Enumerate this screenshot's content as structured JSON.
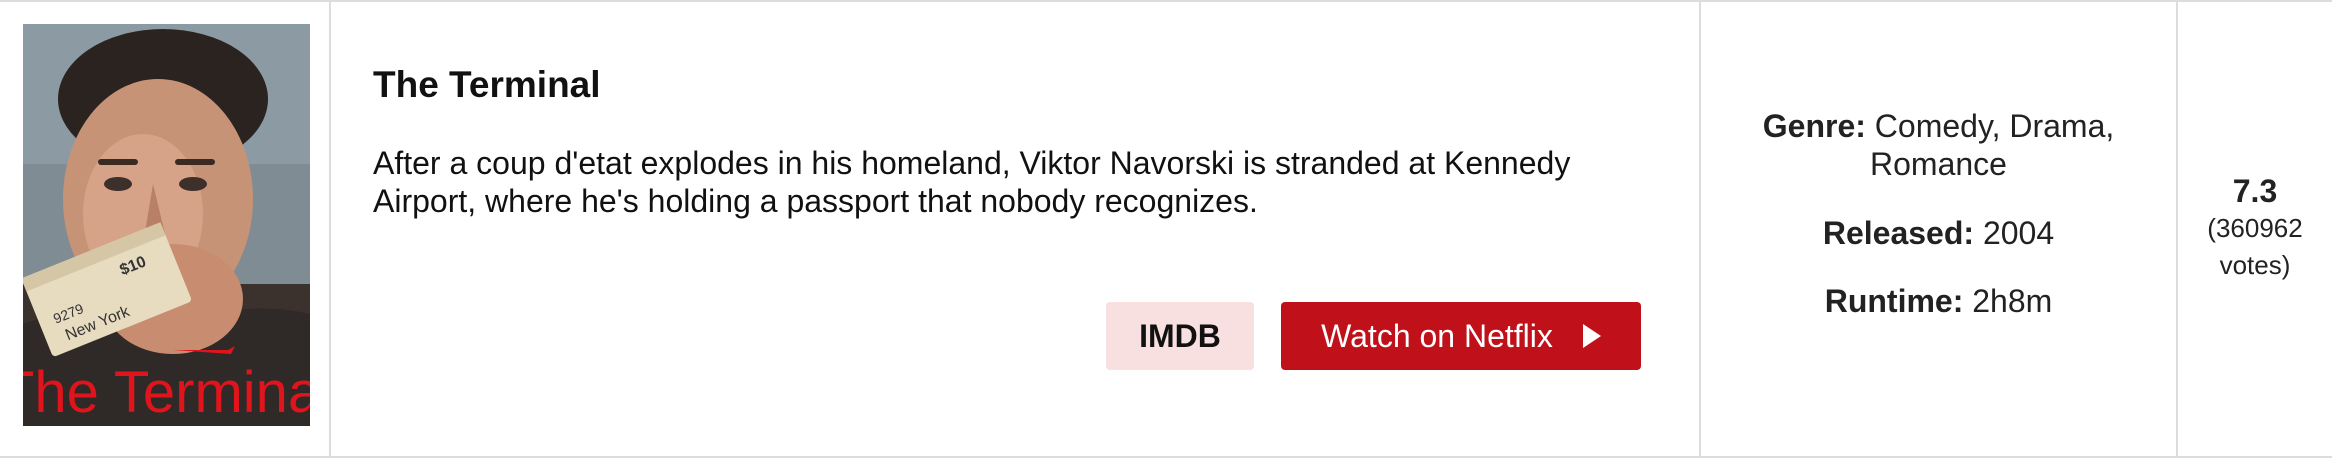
{
  "movie": {
    "title": "The Terminal",
    "description": "After a coup d'etat explodes in his homeland, Viktor Navorski is stranded at Kennedy Airport, where he's holding a passport that nobody recognizes.",
    "poster": {
      "title_art": "The Terminal",
      "ticket_text": "New York",
      "ticket_price": "$10",
      "ticket_code": "9279"
    }
  },
  "buttons": {
    "imdb_label": "IMDB",
    "netflix_label": "Watch on Netflix",
    "netflix_icon": "play-icon"
  },
  "meta": {
    "genre_key": "Genre:",
    "genre_value": "Comedy, Drama, Romance",
    "released_key": "Released:",
    "released_value": "2004",
    "runtime_key": "Runtime:",
    "runtime_value": "2h8m"
  },
  "rating": {
    "score": "7.3",
    "votes": "(360962 votes)"
  },
  "colors": {
    "netflix_red": "#c0111b",
    "imdb_bg": "#f9e0e0",
    "border": "#dcdcdc",
    "poster_title": "#e0141c"
  }
}
